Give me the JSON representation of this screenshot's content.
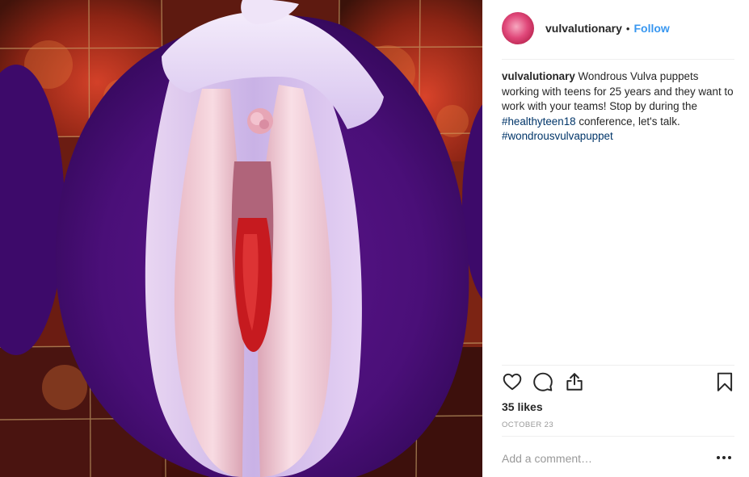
{
  "post": {
    "image_alt": "Wondrous Vulva puppet on a quilt",
    "author": {
      "username": "vulvalutionary",
      "separator": "•",
      "follow_label": "Follow"
    },
    "caption": {
      "username": "vulvalutionary",
      "text_1": " Wondrous Vulva puppets working with teens for 25 years and they want to work with your teams! Stop by during the ",
      "hashtag_1": "#healthyteen18",
      "text_2": " conference, let's talk. ",
      "hashtag_2": "#wondrousvulvapuppet"
    },
    "actions": {
      "like_icon": "heart-icon",
      "comment_icon": "comment-icon",
      "share_icon": "share-icon",
      "save_icon": "bookmark-icon"
    },
    "likes_text": "35 likes",
    "date_text": "OCTOBER 23",
    "comment": {
      "placeholder": "Add a comment…",
      "value": "",
      "more_icon": "more-options-icon"
    }
  },
  "colors": {
    "follow": "#3897f0",
    "hashtag": "#003569",
    "muted": "#999999",
    "text": "#262626"
  }
}
